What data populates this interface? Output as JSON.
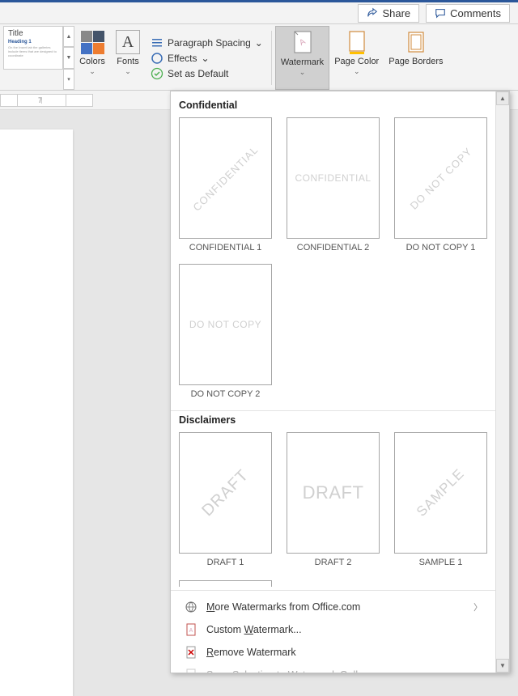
{
  "titlebar": {
    "share": "Share",
    "comments": "Comments"
  },
  "ribbon": {
    "theme_preview": {
      "title": "Title",
      "heading": "Heading 1"
    },
    "colors": "Colors",
    "fonts": "Fonts",
    "para_spacing": "Paragraph Spacing",
    "effects": "Effects",
    "set_default": "Set as Default",
    "watermark": "Watermark",
    "page_color": "Page Color",
    "page_borders": "Page Borders"
  },
  "ruler": {
    "num": "7"
  },
  "gallery": {
    "sections": [
      {
        "title": "Confidential",
        "items": [
          {
            "wm": "CONFIDENTIAL",
            "diag": true,
            "label": "CONFIDENTIAL 1"
          },
          {
            "wm": "CONFIDENTIAL",
            "diag": false,
            "label": "CONFIDENTIAL 2"
          },
          {
            "wm": "DO NOT COPY",
            "diag": true,
            "label": "DO NOT COPY 1"
          },
          {
            "wm": "DO NOT COPY",
            "diag": false,
            "label": "DO NOT COPY 2"
          }
        ]
      },
      {
        "title": "Disclaimers",
        "items": [
          {
            "wm": "DRAFT",
            "diag": true,
            "label": "DRAFT 1"
          },
          {
            "wm": "DRAFT",
            "diag": false,
            "label": "DRAFT 2"
          },
          {
            "wm": "SAMPLE",
            "diag": true,
            "label": "SAMPLE 1"
          }
        ]
      }
    ],
    "menu": {
      "more": "More Watermarks from Office.com",
      "custom": "Custom Watermark...",
      "remove": "Remove Watermark",
      "save": "Save Selection to Watermark Gallery..."
    },
    "underline": {
      "more": "M",
      "custom": "W",
      "remove": "R",
      "save": "S"
    }
  }
}
